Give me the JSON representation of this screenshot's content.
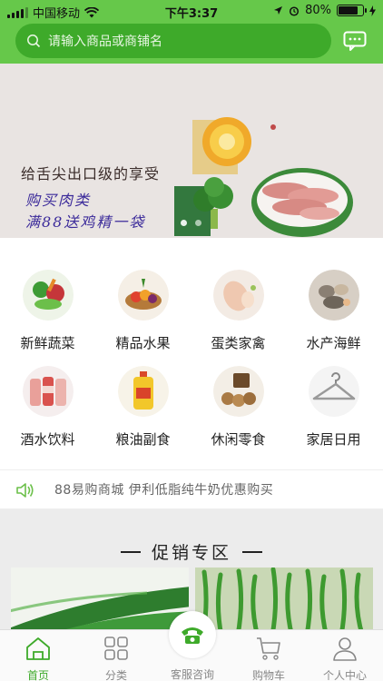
{
  "status_bar": {
    "carrier": "中国移动",
    "time": "下午3:37",
    "battery": "80%",
    "battery_level": 0.8
  },
  "search": {
    "placeholder": "请输入商品或商铺名"
  },
  "banner": {
    "title": "给舌尖出口级的享受",
    "line1": "购买肉类",
    "line2": "满88送鸡精一袋",
    "dots": 2,
    "active_dot": 0
  },
  "categories": [
    {
      "label": "新鲜蔬菜",
      "icon": "vegetables-icon"
    },
    {
      "label": "精品水果",
      "icon": "fruit-icon"
    },
    {
      "label": "蛋类家禽",
      "icon": "poultry-icon"
    },
    {
      "label": "水产海鲜",
      "icon": "seafood-icon"
    },
    {
      "label": "酒水饮料",
      "icon": "drinks-icon"
    },
    {
      "label": "粮油副食",
      "icon": "oil-icon"
    },
    {
      "label": "休闲零食",
      "icon": "snacks-icon"
    },
    {
      "label": "家居日用",
      "icon": "hanger-icon"
    }
  ],
  "notice": {
    "text": "88易购商城  伊利低脂纯牛奶优惠购买"
  },
  "promo": {
    "title": "促销专区"
  },
  "tabbar": {
    "active": "home",
    "items": [
      {
        "label": "首页",
        "icon": "home-icon"
      },
      {
        "label": "分类",
        "icon": "category-grid-icon"
      },
      {
        "label": "客服咨询",
        "icon": "phone-icon"
      },
      {
        "label": "购物车",
        "icon": "cart-icon"
      },
      {
        "label": "个人中心",
        "icon": "user-icon"
      }
    ]
  },
  "colors": {
    "brand": "#66c84a",
    "brand_dark": "#3eaa2a",
    "banner_text": "#3b2a9a"
  }
}
